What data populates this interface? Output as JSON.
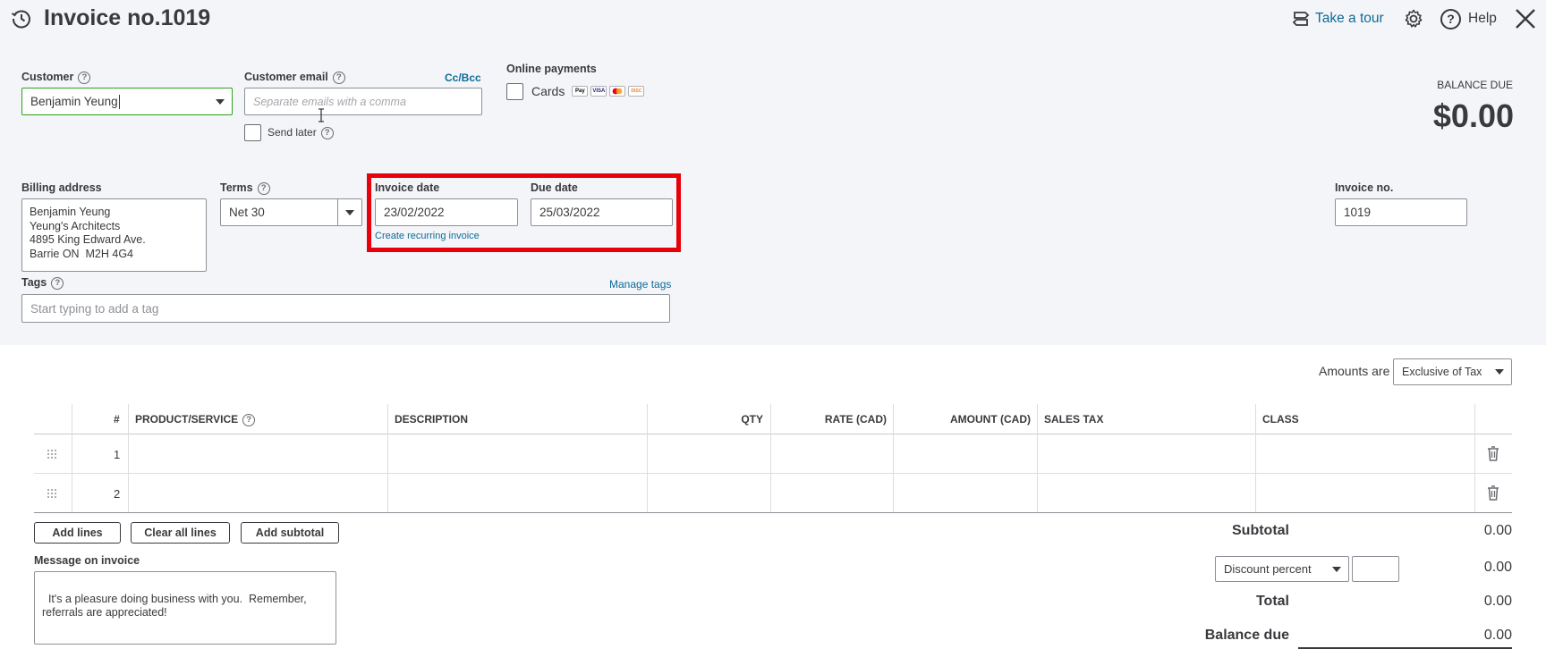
{
  "header": {
    "title": "Invoice no.1019",
    "take_a_tour": "Take a tour",
    "help": "Help"
  },
  "customer": {
    "label": "Customer",
    "value": "Benjamin Yeung"
  },
  "customer_email": {
    "label": "Customer email",
    "placeholder": "Separate emails with a comma",
    "cc_bcc": "Cc/Bcc",
    "send_later": "Send later"
  },
  "online_payments": {
    "label": "Online payments",
    "cards": "Cards",
    "card_logos": [
      "Pay",
      "VISA",
      "mc",
      "DISC"
    ]
  },
  "balance": {
    "label": "BALANCE DUE",
    "amount": "$0.00"
  },
  "billing": {
    "label": "Billing address",
    "lines": [
      "Benjamin Yeung",
      "Yeung's Architects",
      "4895 King Edward Ave.",
      "Barrie ON  M2H 4G4"
    ]
  },
  "terms": {
    "label": "Terms",
    "value": "Net 30"
  },
  "invoice_date": {
    "label": "Invoice date",
    "value": "23/02/2022"
  },
  "due_date": {
    "label": "Due date",
    "value": "25/03/2022"
  },
  "create_recurring": "Create recurring invoice",
  "invoice_no": {
    "label": "Invoice no.",
    "value": "1019"
  },
  "tags": {
    "label": "Tags",
    "manage": "Manage tags",
    "placeholder": "Start typing to add a tag"
  },
  "amounts_are": {
    "label": "Amounts are",
    "value": "Exclusive of Tax"
  },
  "table": {
    "columns": [
      "#",
      "PRODUCT/SERVICE",
      "DESCRIPTION",
      "QTY",
      "RATE (CAD)",
      "AMOUNT (CAD)",
      "SALES TAX",
      "CLASS"
    ],
    "rows": [
      {
        "num": "1"
      },
      {
        "num": "2"
      }
    ]
  },
  "buttons": {
    "add_lines": "Add lines",
    "clear_all_lines": "Clear all lines",
    "add_subtotal": "Add subtotal"
  },
  "message": {
    "label": "Message on invoice",
    "value": "It's a pleasure doing business with you.  Remember, referrals are appreciated!"
  },
  "totals": {
    "subtotal_label": "Subtotal",
    "subtotal_value": "0.00",
    "discount_type": "Discount percent",
    "discount_value": "0.00",
    "total_label": "Total",
    "total_value": "0.00",
    "balance_due_label": "Balance due",
    "balance_due_value": "0.00"
  },
  "colors": {
    "highlight": "#e8000b",
    "link": "#0d6b9a",
    "customer_border": "#2ca01c",
    "top_background": "#f4f5f8"
  }
}
